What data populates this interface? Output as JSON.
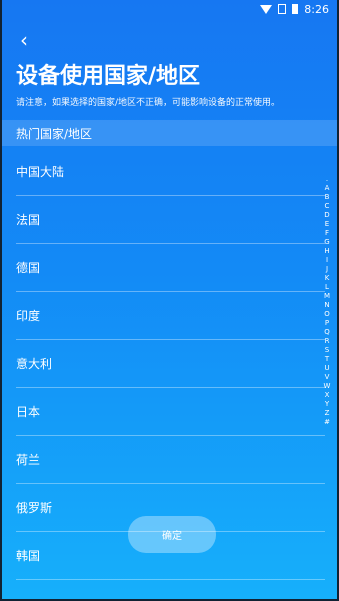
{
  "status_bar": {
    "time": "8:26"
  },
  "page": {
    "title": "设备使用国家/地区",
    "subtitle": "请注意，如果选择的国家/地区不正确，可能影响设备的正常使用。"
  },
  "section": {
    "header": "热门国家/地区"
  },
  "countries": [
    "中国大陆",
    "法国",
    "德国",
    "印度",
    "意大利",
    "日本",
    "荷兰",
    "俄罗斯",
    "韩国"
  ],
  "index_letters": [
    ".",
    "A",
    "B",
    "C",
    "D",
    "E",
    "F",
    "G",
    "H",
    "I",
    "J",
    "K",
    "L",
    "M",
    "N",
    "O",
    "P",
    "Q",
    "R",
    "S",
    "T",
    "U",
    "V",
    "W",
    "X",
    "Y",
    "Z",
    "#"
  ],
  "buttons": {
    "confirm": "确定"
  },
  "colors": {
    "bg_top": "#1677f2",
    "bg_bottom": "#16b0fb"
  }
}
